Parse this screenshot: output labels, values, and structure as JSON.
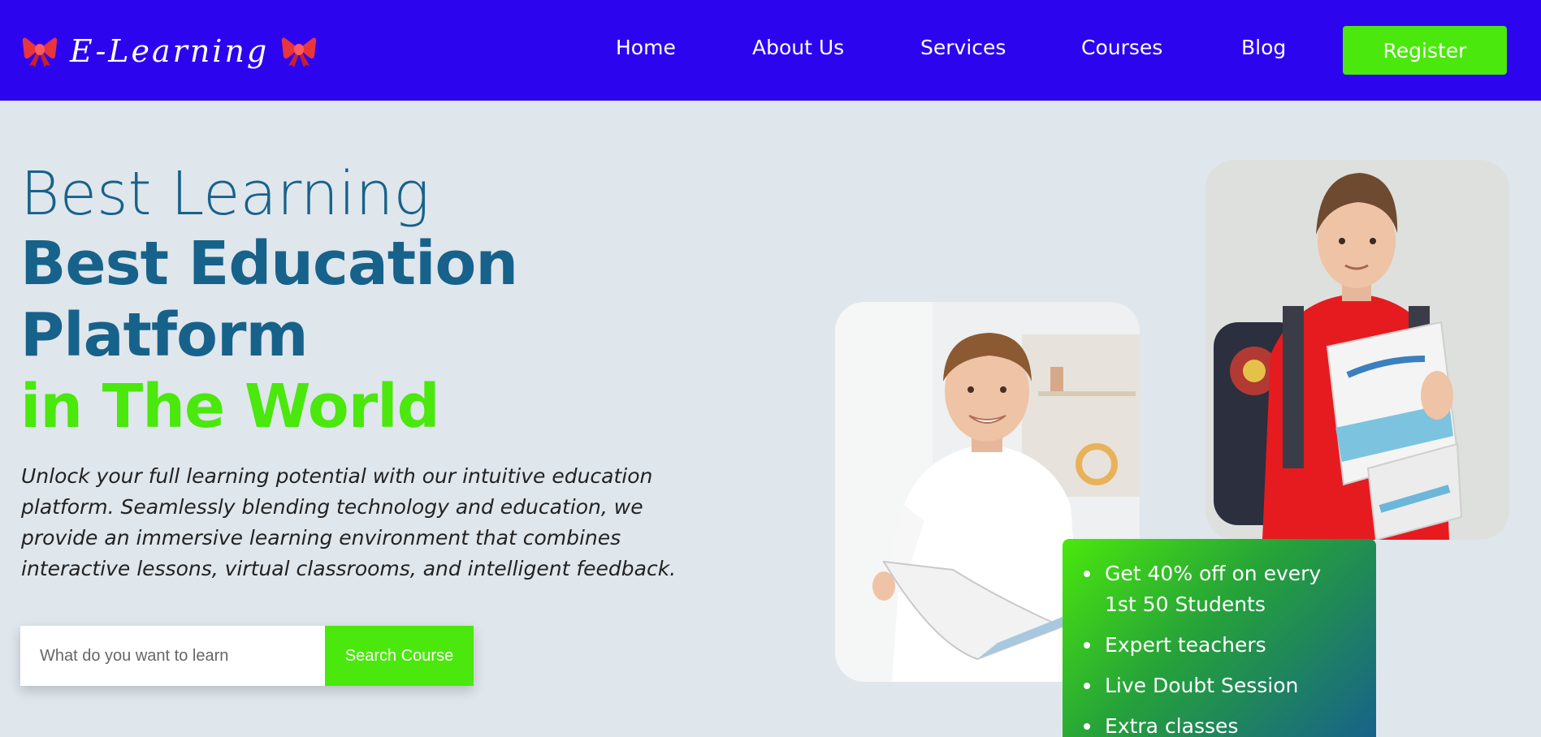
{
  "header": {
    "logo_text": "E-Learning",
    "logo_icon": "ribbon-bow-icon",
    "nav": [
      {
        "label": "Home"
      },
      {
        "label": "About Us"
      },
      {
        "label": "Services"
      },
      {
        "label": "Courses"
      },
      {
        "label": "Blog"
      }
    ],
    "register_label": "Register"
  },
  "hero": {
    "line1": "Best Learning",
    "line2": "Best Education",
    "line3": "Platform",
    "line4": "in The World",
    "description": "Unlock your full learning potential with our intuitive education platform. Seamlessly blending technology and education, we provide an immersive learning environment that combines interactive lessons, virtual classrooms, and intelligent feedback."
  },
  "search": {
    "placeholder": "What do you want to learn",
    "value": "",
    "button_label": "Search Course"
  },
  "features": {
    "items": [
      {
        "text": "Get 40% off on every 1st 50 Students"
      },
      {
        "text": "Expert teachers"
      },
      {
        "text": "Live Doubt Session"
      },
      {
        "text": "Extra classes"
      }
    ]
  },
  "colors": {
    "header_bg": "#2c05ee",
    "accent_green": "#4ae80c",
    "heading_blue": "#17628a",
    "page_bg": "#dfe6ec"
  }
}
